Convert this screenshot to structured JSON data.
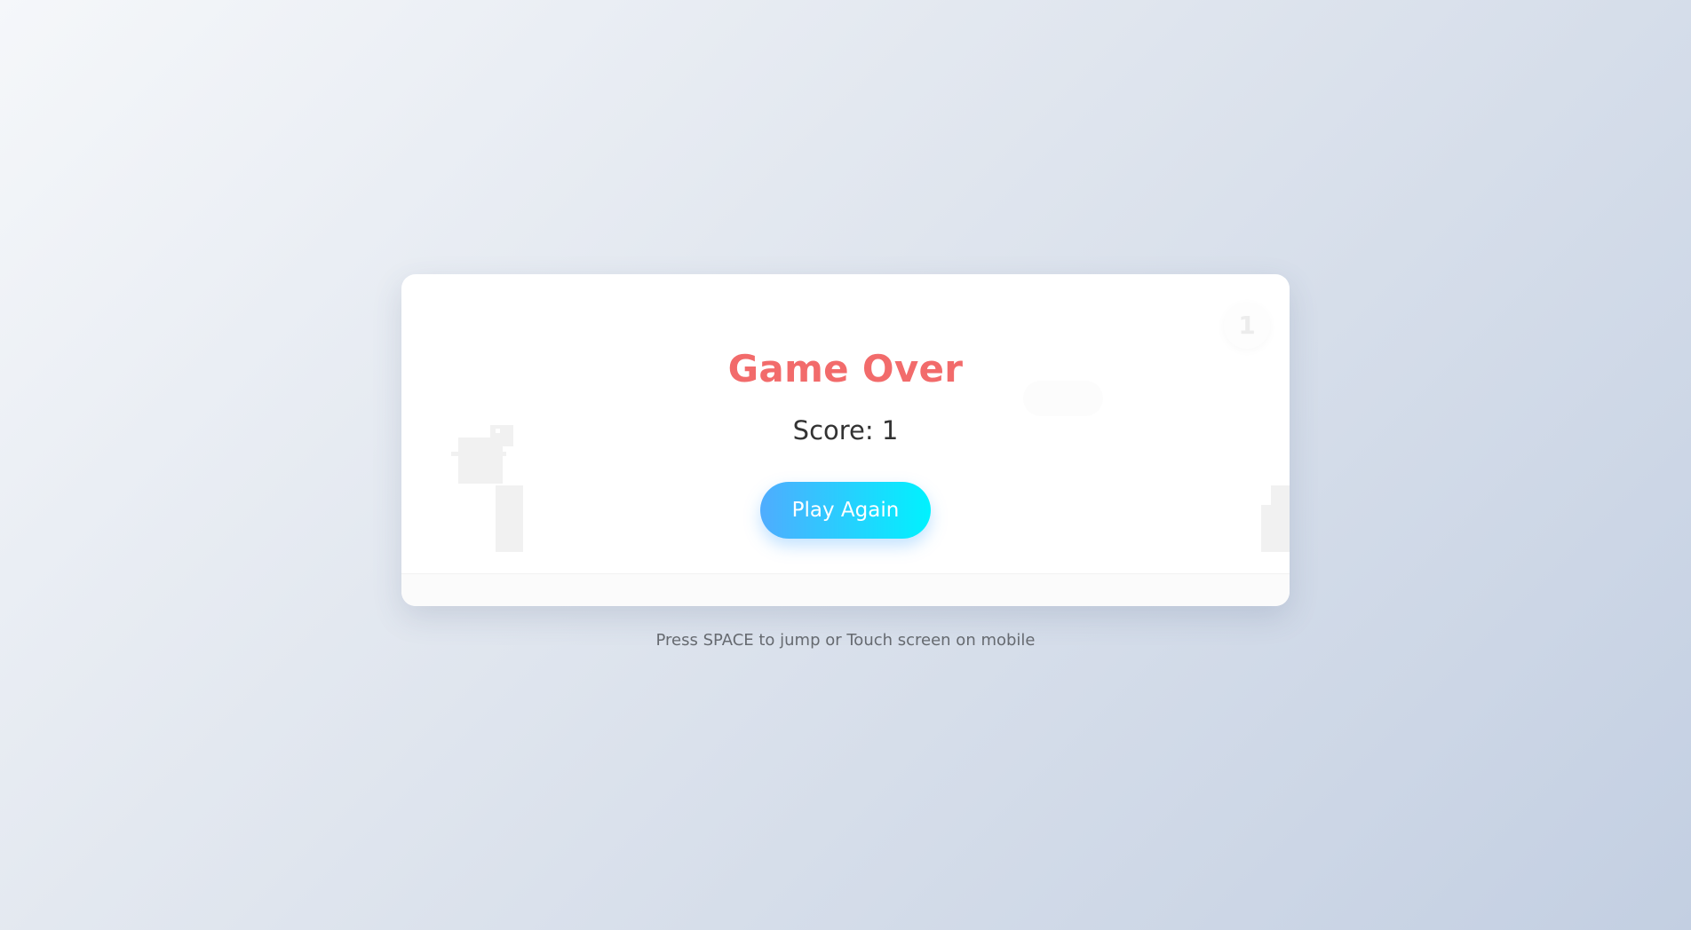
{
  "game": {
    "score_badge": "1",
    "title": "Game Over",
    "score_text": "Score: 1",
    "play_again_label": "Play Again",
    "hint": "Press SPACE to jump or Touch screen on mobile"
  },
  "colors": {
    "title": "#f26b6b",
    "button_gradient_start": "#4facfe",
    "button_gradient_end": "#00f2fe",
    "background_start": "#f5f7fa",
    "background_end": "#c3cfe2"
  },
  "icons": {
    "player": "dino-sprite",
    "obstacles": [
      "cactus-obstacle",
      "cactus-obstacle"
    ]
  }
}
